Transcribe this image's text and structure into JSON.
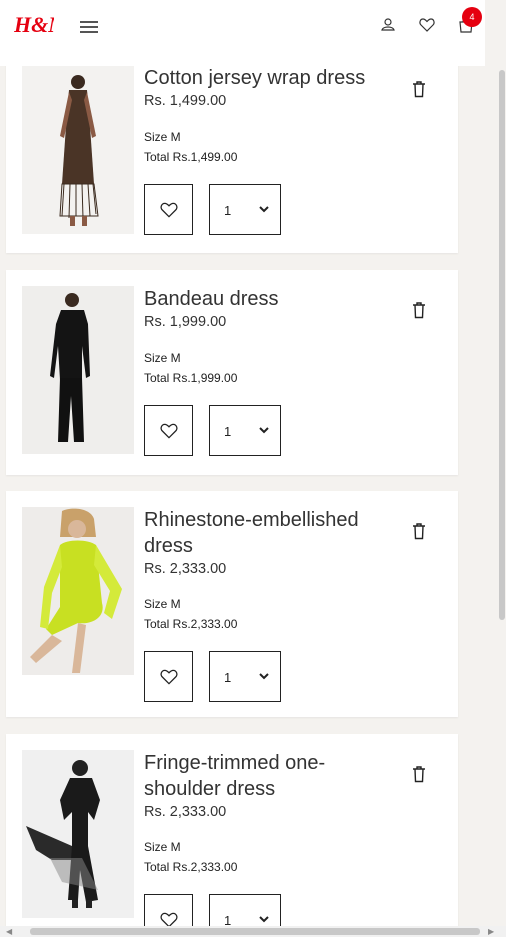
{
  "header": {
    "logo_text": "H&M",
    "cart_count": "4"
  },
  "items": [
    {
      "title": "Cotton jersey wrap dress",
      "price": "Rs. 1,499.00",
      "size": "Size M",
      "total": "Total Rs.1,499.00",
      "qty": "1"
    },
    {
      "title": "Bandeau dress",
      "price": "Rs. 1,999.00",
      "size": "Size M",
      "total": "Total Rs.1,999.00",
      "qty": "1"
    },
    {
      "title": "Rhinestone-embellished dress",
      "price": "Rs. 2,333.00",
      "size": "Size M",
      "total": "Total Rs.2,333.00",
      "qty": "1"
    },
    {
      "title": "Fringe-trimmed one-shoulder dress",
      "price": "Rs. 2,333.00",
      "size": "Size M",
      "total": "Total Rs.2,333.00",
      "qty": "1"
    }
  ],
  "colors": {
    "brand": "#e50010",
    "background": "#f4f2ef"
  }
}
